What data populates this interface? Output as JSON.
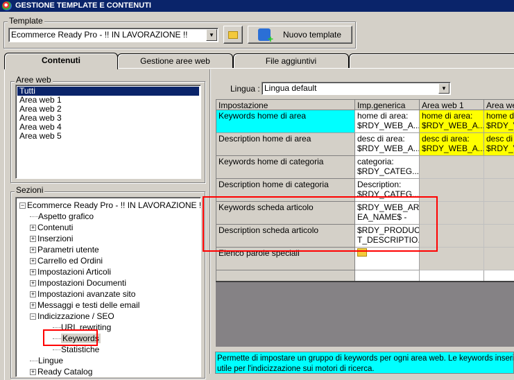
{
  "window": {
    "title": "GESTIONE TEMPLATE E CONTENUTI"
  },
  "template": {
    "label": "Template",
    "value": "Ecommerce Ready Pro - !! IN LAVORAZIONE !!",
    "new_button": "Nuovo template"
  },
  "tabs": [
    "Contenuti",
    "Gestione aree web",
    "File aggiuntivi",
    ""
  ],
  "aree_web": {
    "label": "Aree web",
    "items": [
      "Tutti",
      "Area web 1",
      "Area web 2",
      "Area web 3",
      "Area web 4",
      "Area web 5"
    ],
    "selected": "Tutti"
  },
  "sezioni": {
    "label": "Sezioni",
    "root": "Ecommerce Ready Pro - !! IN LAVORAZIONE !!",
    "items": [
      {
        "label": "Aspetto grafico",
        "level": 1,
        "expander": ""
      },
      {
        "label": "Contenuti",
        "level": 1,
        "expander": "+"
      },
      {
        "label": "Inserzioni",
        "level": 1,
        "expander": "+"
      },
      {
        "label": "Parametri utente",
        "level": 1,
        "expander": "+"
      },
      {
        "label": "Carrello ed Ordini",
        "level": 1,
        "expander": "+"
      },
      {
        "label": "Impostazioni Articoli",
        "level": 1,
        "expander": "+"
      },
      {
        "label": "Impostazioni Documenti",
        "level": 1,
        "expander": "+"
      },
      {
        "label": "Impostazioni avanzate sito",
        "level": 1,
        "expander": "+"
      },
      {
        "label": "Messaggi e testi delle email",
        "level": 1,
        "expander": "+"
      },
      {
        "label": "Indicizzazione / SEO",
        "level": 1,
        "expander": "-"
      },
      {
        "label": "URL rewriting",
        "level": 2,
        "expander": ""
      },
      {
        "label": "Keywords",
        "level": 2,
        "expander": "",
        "selected": true
      },
      {
        "label": "Statistiche",
        "level": 2,
        "expander": ""
      },
      {
        "label": "Lingue",
        "level": 1,
        "expander": ""
      },
      {
        "label": "Ready Catalog",
        "level": 1,
        "expander": "+"
      }
    ]
  },
  "lingua": {
    "label": "Lingua :",
    "value": "Lingua default"
  },
  "grid": {
    "headers": [
      "Impostazione",
      "Imp.generica",
      "Area web 1",
      "Area we"
    ],
    "rows": [
      {
        "name": "Keywords home di area",
        "generic": [
          "home di area:",
          "$RDY_WEB_A..."
        ],
        "a1": [
          "home di area:",
          "$RDY_WEB_A..."
        ],
        "a2": [
          "home di",
          "$RDY_V"
        ]
      },
      {
        "name": "Description home di area",
        "generic": [
          "desc di area:",
          "$RDY_WEB_A..."
        ],
        "a1": [
          "desc di area:",
          "$RDY_WEB_A..."
        ],
        "a2": [
          "desc di a",
          "$RDY_V"
        ]
      },
      {
        "name": "Keywords home di categoria",
        "generic": [
          "categoria:",
          "$RDY_CATEG..."
        ]
      },
      {
        "name": "Description home di categoria",
        "generic": [
          "Description:",
          "$RDY_CATEG..."
        ]
      },
      {
        "name": "Keywords scheda articolo",
        "generic": [
          "$RDY_WEB_AR",
          "EA_NAME$ -"
        ]
      },
      {
        "name": "Description scheda articolo",
        "generic": [
          "$RDY_PRODUC",
          "T_DESCRIPTIO..."
        ]
      },
      {
        "name": "Elenco parole speciali",
        "generic": []
      }
    ]
  },
  "info": {
    "line1": "Permette di impostare un gruppo di keywords per ogni area web. Le keywords inserite sa",
    "line2": "utile per l'indicizzazione sui motori di ricerca."
  }
}
